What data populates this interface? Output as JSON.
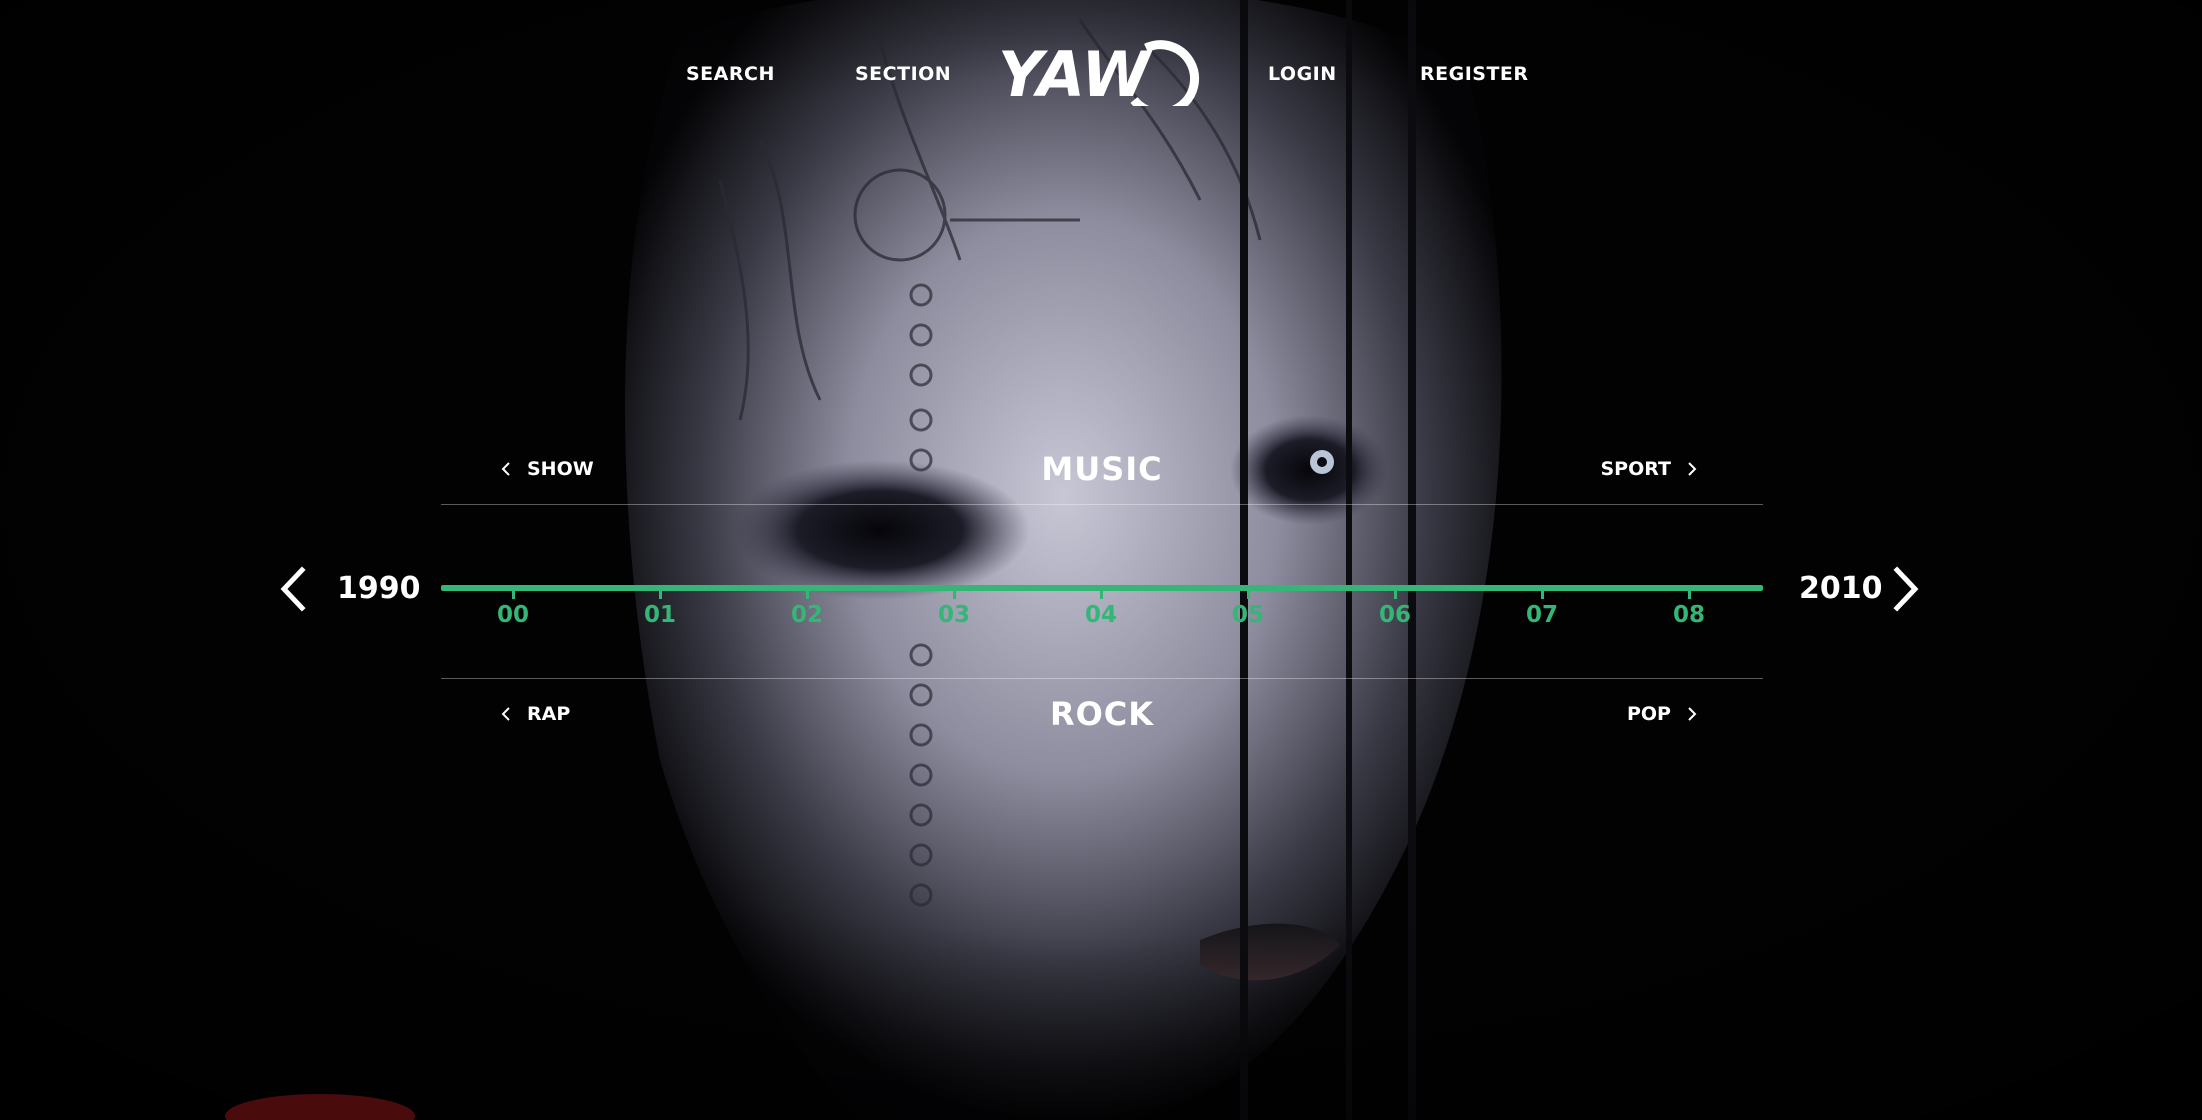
{
  "nav": {
    "search_label": "SEARCH",
    "section_label": "SECTION",
    "login_label": "LOGIN",
    "register_label": "REGISTER"
  },
  "logo": {
    "text": "YAW"
  },
  "section_switcher": {
    "prev_label": "SHOW",
    "current_label": "MUSIC",
    "next_label": "SPORT"
  },
  "genre_switcher": {
    "prev_label": "RAP",
    "current_label": "ROCK",
    "next_label": "POP"
  },
  "timeline": {
    "start_year": "1990",
    "end_year": "2010",
    "ticks": [
      "00",
      "01",
      "02",
      "03",
      "04",
      "05",
      "06",
      "07",
      "08"
    ],
    "accent_color": "#33b676"
  },
  "icons": {
    "year_prev": "chevron-left-icon",
    "year_next": "chevron-right-icon",
    "category_prev": "chevron-left-small-icon",
    "category_next": "chevron-right-small-icon"
  }
}
